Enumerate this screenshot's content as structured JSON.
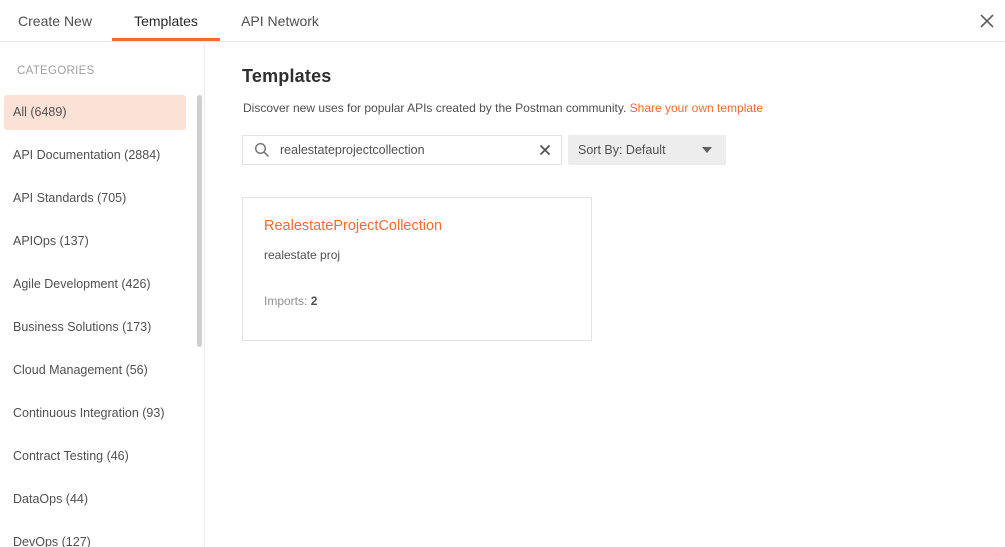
{
  "tabs": [
    {
      "label": "Create New"
    },
    {
      "label": "Templates"
    },
    {
      "label": "API Network"
    }
  ],
  "sidebar": {
    "title": "CATEGORIES",
    "items": [
      {
        "label": "All (6489)"
      },
      {
        "label": "API Documentation (2884)"
      },
      {
        "label": "API Standards (705)"
      },
      {
        "label": "APIOps (137)"
      },
      {
        "label": "Agile Development (426)"
      },
      {
        "label": "Business Solutions (173)"
      },
      {
        "label": "Cloud Management (56)"
      },
      {
        "label": "Continuous Integration (93)"
      },
      {
        "label": "Contract Testing (46)"
      },
      {
        "label": "DataOps (44)"
      },
      {
        "label": "DevOps (127)"
      }
    ]
  },
  "main": {
    "title": "Templates",
    "subtitle": "Discover new uses for popular APIs created by the Postman community.",
    "subtitle_link": "Share your own template",
    "search": {
      "value": "realestateprojectcollection"
    },
    "sort": {
      "label": "Sort By: Default"
    },
    "cards": [
      {
        "title": "RealestateProjectCollection",
        "description": "realestate proj",
        "imports_label": "Imports:",
        "imports_count": "2"
      }
    ]
  },
  "colors": {
    "accent": "#f26b3a",
    "active_bg": "#fce1d7"
  },
  "icons": [
    "close-icon",
    "search-icon",
    "clear-search-icon",
    "caret-down-icon"
  ]
}
